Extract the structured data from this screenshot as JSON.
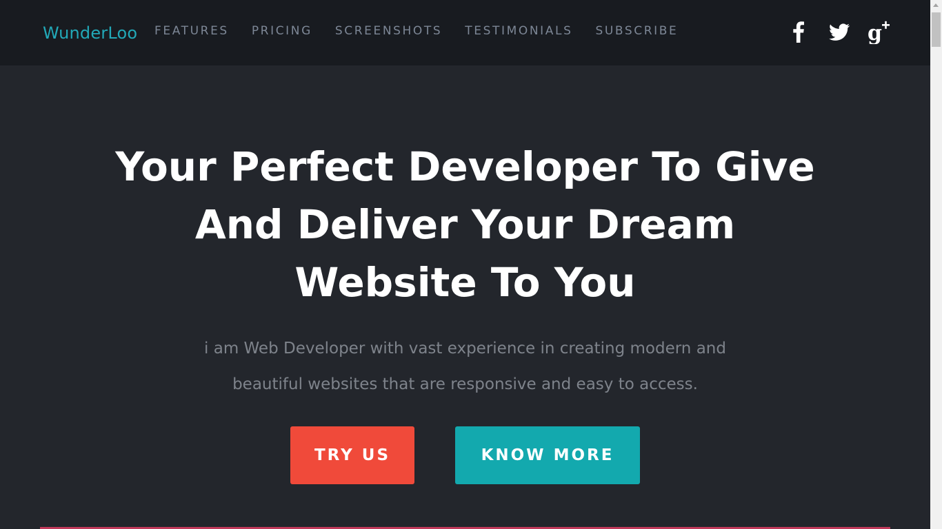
{
  "brand": "WunderLoo",
  "nav": {
    "items": [
      {
        "label": "FEATURES"
      },
      {
        "label": "PRICING"
      },
      {
        "label": "SCREENSHOTS"
      },
      {
        "label": "TESTIMONIALS"
      },
      {
        "label": "SUBSCRIBE"
      }
    ]
  },
  "social": {
    "icons": [
      "facebook-icon",
      "twitter-icon",
      "google-plus-icon"
    ]
  },
  "hero": {
    "title_lines": [
      "Your Perfect Developer To Give",
      "And Deliver Your Dream",
      "Website To You"
    ],
    "subtitle_lines": [
      "i am Web Developer with vast experience in creating modern and",
      "beautiful websites that are responsive and easy to access."
    ],
    "primary_button": "TRY US",
    "secondary_button": "KNOW MORE"
  },
  "colors": {
    "brand": "#22a9b8",
    "navbar_bg": "#181b20",
    "hero_bg": "#23262c",
    "try_button": "#f04a3a",
    "know_more_button": "#13a9ae"
  }
}
